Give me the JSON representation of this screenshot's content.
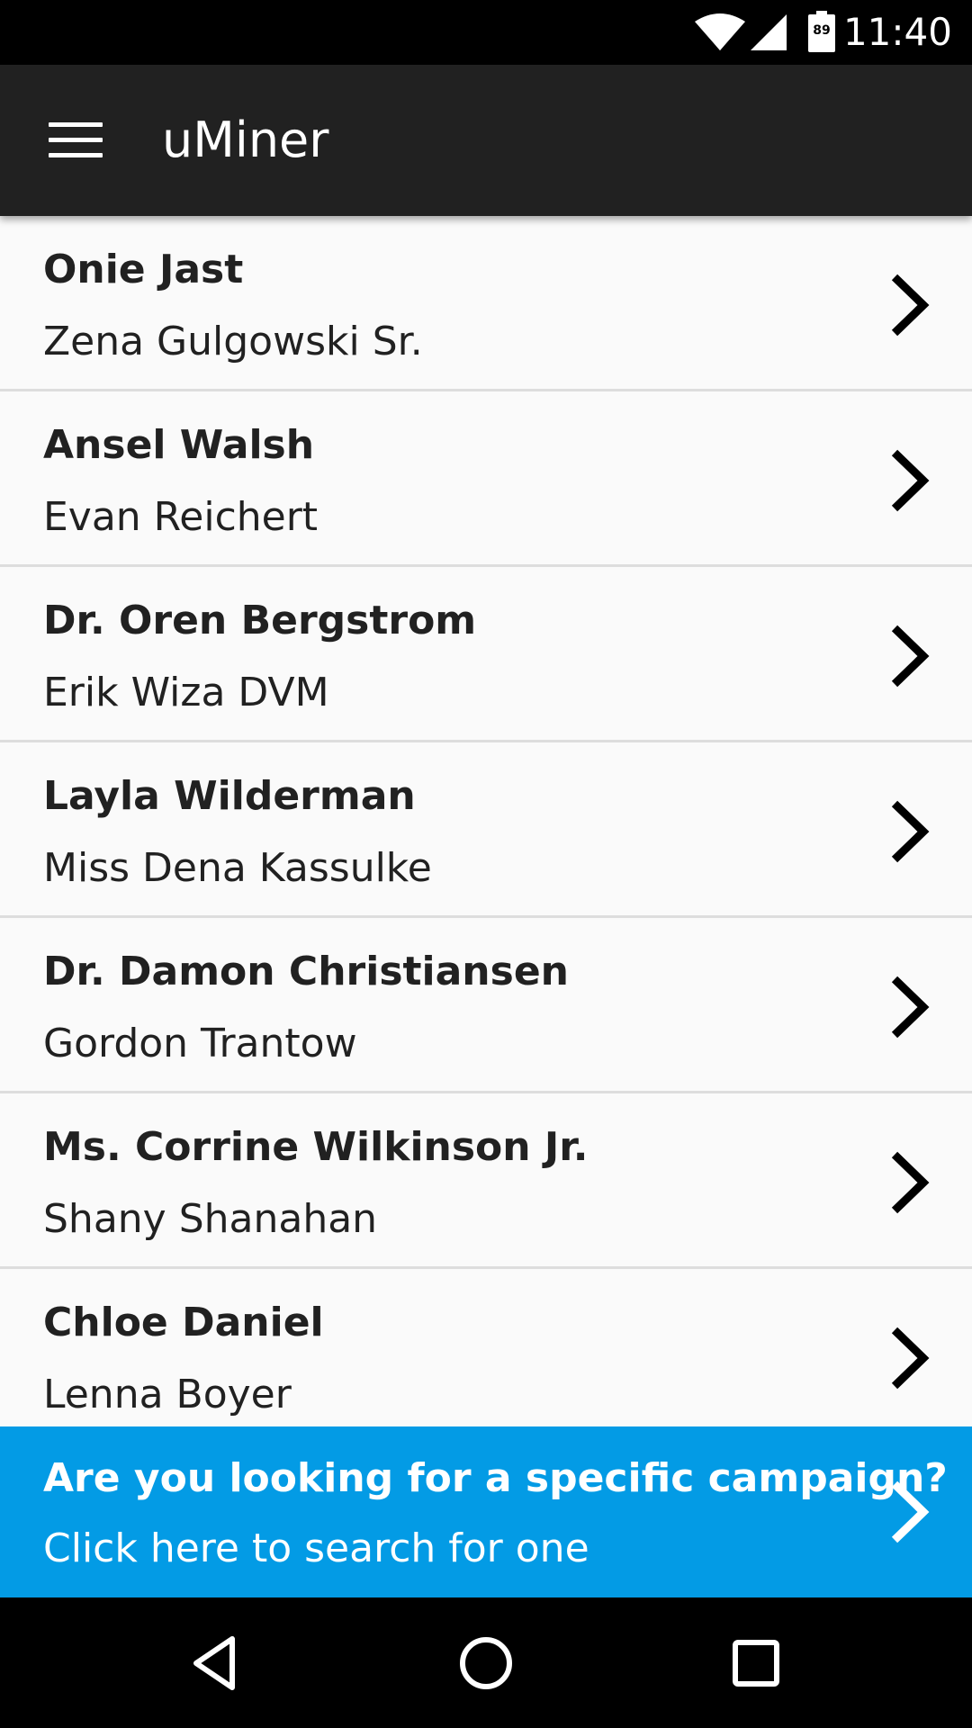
{
  "status_bar": {
    "battery_level": "89",
    "time": "11:40",
    "icons": [
      "wifi-icon",
      "signal-icon",
      "battery-icon"
    ]
  },
  "app_bar": {
    "title": "uMiner",
    "menu_icon": "hamburger-menu-icon",
    "background": "#212121"
  },
  "list": {
    "items": [
      {
        "title": "Onie Jast",
        "subtitle": "Zena Gulgowski Sr."
      },
      {
        "title": "Ansel Walsh",
        "subtitle": "Evan Reichert"
      },
      {
        "title": "Dr. Oren Bergstrom",
        "subtitle": "Erik Wiza DVM"
      },
      {
        "title": "Layla Wilderman",
        "subtitle": "Miss Dena Kassulke"
      },
      {
        "title": "Dr. Damon Christiansen",
        "subtitle": "Gordon Trantow"
      },
      {
        "title": "Ms. Corrine Wilkinson Jr.",
        "subtitle": "Shany Shanahan"
      },
      {
        "title": "Chloe Daniel",
        "subtitle": "Lenna Boyer"
      }
    ],
    "chevron_icon": "chevron-right-icon"
  },
  "search_banner": {
    "title": "Are you looking for a specific campaign?",
    "subtitle": "Click here to search for one",
    "background": "#039be5"
  },
  "nav_bar": {
    "buttons": [
      "back-icon",
      "home-icon",
      "recents-icon"
    ]
  }
}
